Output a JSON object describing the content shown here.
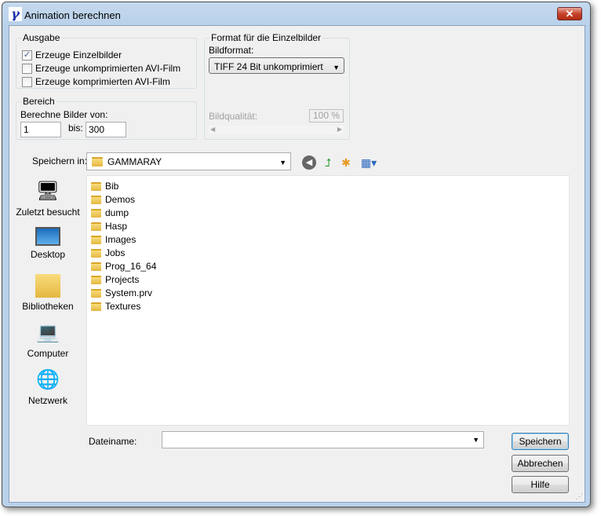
{
  "window": {
    "title": "Animation berechnen",
    "close": "✕"
  },
  "ausgabe": {
    "legend": "Ausgabe",
    "options": [
      {
        "label": "Erzeuge Einzelbilder",
        "checked": true
      },
      {
        "label": "Erzeuge unkomprimierten AVI-Film",
        "checked": false
      },
      {
        "label": "Erzeuge komprimierten AVI-Film",
        "checked": false
      }
    ]
  },
  "bereich": {
    "legend": "Bereich",
    "label": "Berechne Bilder von:",
    "from": "1",
    "to_label": "bis:",
    "to": "300"
  },
  "format": {
    "legend": "Format für die Einzelbilder",
    "bildformat_label": "Bildformat:",
    "bildformat": "TIFF 24 Bit unkomprimiert",
    "quality_label": "Bildqualität:",
    "quality": "100 %"
  },
  "save_in": {
    "label": "Speichern in:",
    "value": "GAMMARAY"
  },
  "places": [
    {
      "label": "Zuletzt besucht",
      "icon": "recent-icon"
    },
    {
      "label": "Desktop",
      "icon": "desktop-icon"
    },
    {
      "label": "Bibliotheken",
      "icon": "libraries-icon"
    },
    {
      "label": "Computer",
      "icon": "computer-icon"
    },
    {
      "label": "Netzwerk",
      "icon": "network-icon"
    }
  ],
  "files": [
    "Bib",
    "Demos",
    "dump",
    "Hasp",
    "Images",
    "Jobs",
    "Prog_16_64",
    "Projects",
    "System.prv",
    "Textures"
  ],
  "filename": {
    "label": "Dateiname:",
    "value": ""
  },
  "buttons": {
    "save": "Speichern",
    "cancel": "Abbrechen",
    "help": "Hilfe"
  }
}
